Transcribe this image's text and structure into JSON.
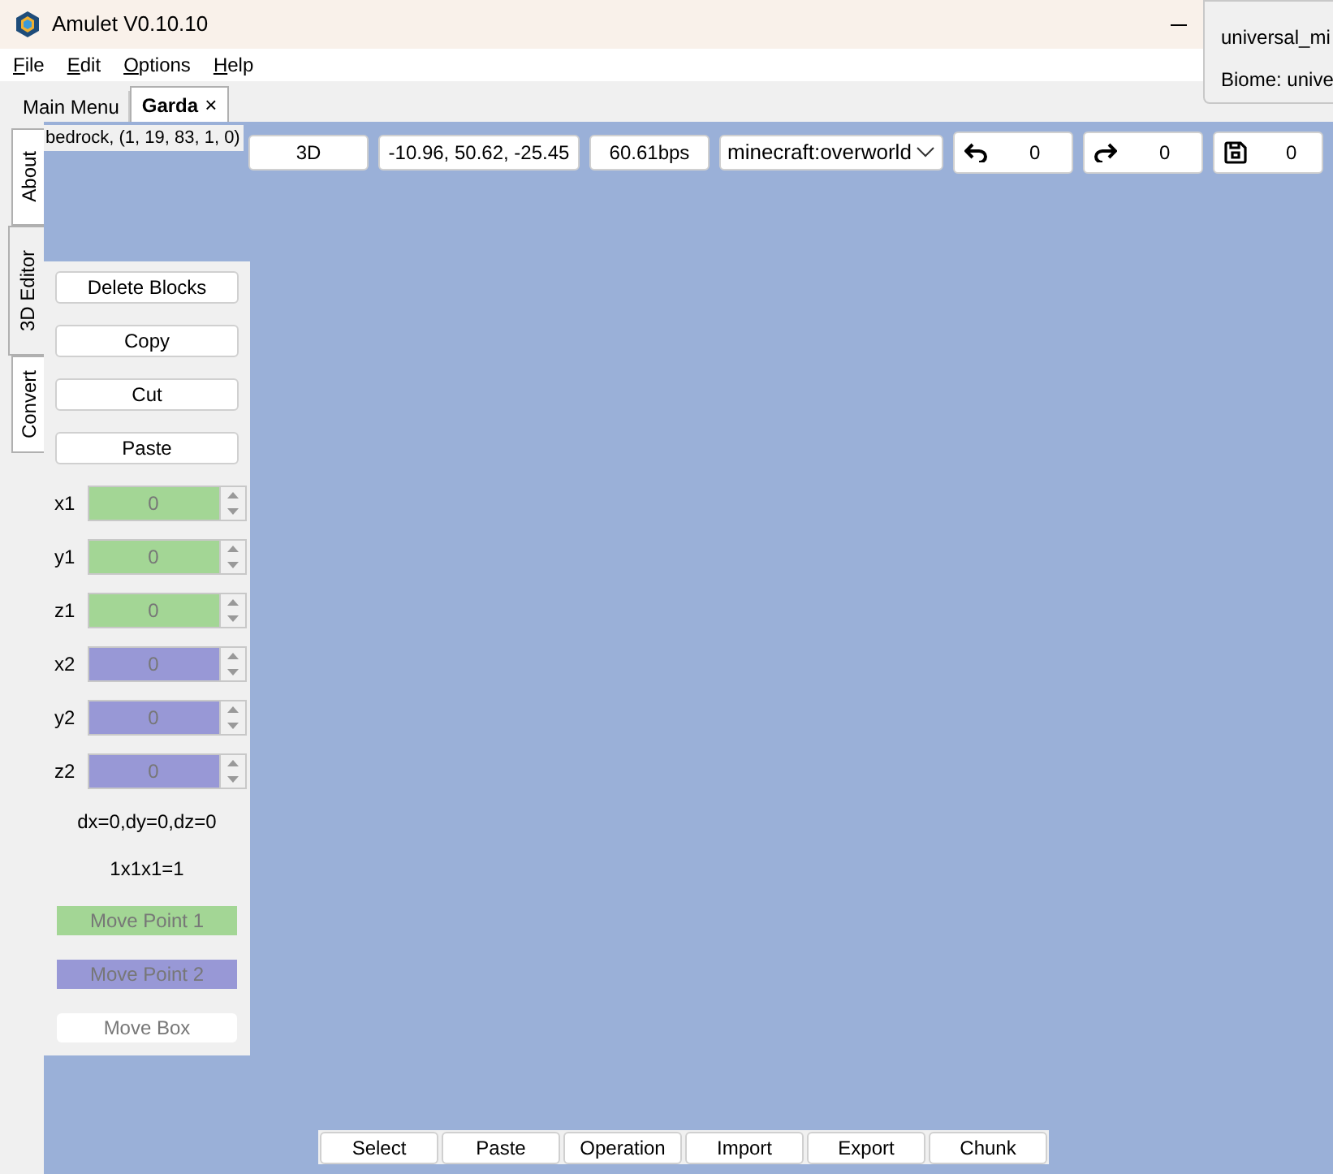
{
  "window": {
    "title": "Amulet V0.10.10"
  },
  "menu": [
    {
      "label": "File"
    },
    {
      "label": "Edit"
    },
    {
      "label": "Options"
    },
    {
      "label": "Help"
    }
  ],
  "tabs": [
    {
      "label": "Main Menu",
      "selected": false
    },
    {
      "label": "Garda",
      "selected": true,
      "close": "×"
    }
  ],
  "side_tabs": [
    {
      "label": "About",
      "selected": false
    },
    {
      "label": "3D Editor",
      "selected": true
    },
    {
      "label": "Convert",
      "selected": false
    }
  ],
  "block_label": "bedrock, (1, 19, 83, 1, 0)",
  "toolbar": {
    "view": "3D",
    "position": "-10.96, 50.62, -25.45",
    "speed": "60.61bps",
    "dimension": "minecraft:overworld",
    "undo": "0",
    "redo": "0",
    "save": "0"
  },
  "tooltip": {
    "name": "universal_mi",
    "biome": "Biome: unive"
  },
  "panel": {
    "buttons": [
      "Delete Blocks",
      "Copy",
      "Cut",
      "Paste"
    ],
    "coords": [
      {
        "label": "x1",
        "value": "0",
        "color": "#a3d695"
      },
      {
        "label": "y1",
        "value": "0",
        "color": "#a3d695"
      },
      {
        "label": "z1",
        "value": "0",
        "color": "#a3d695"
      },
      {
        "label": "x2",
        "value": "0",
        "color": "#9898d6"
      },
      {
        "label": "y2",
        "value": "0",
        "color": "#9898d6"
      },
      {
        "label": "z2",
        "value": "0",
        "color": "#9898d6"
      }
    ],
    "delta": "dx=0,dy=0,dz=0",
    "volume": "1x1x1=1",
    "move_buttons": [
      {
        "label": "Move Point 1",
        "color": "#a3d695"
      },
      {
        "label": "Move Point 2",
        "color": "#9898d6"
      },
      {
        "label": "Move Box",
        "color": "#ffffff"
      }
    ]
  },
  "bottom_tools": [
    {
      "label": "Select"
    },
    {
      "label": "Paste"
    },
    {
      "label": "Operation"
    },
    {
      "label": "Import"
    },
    {
      "label": "Export"
    },
    {
      "label": "Chunk"
    }
  ]
}
